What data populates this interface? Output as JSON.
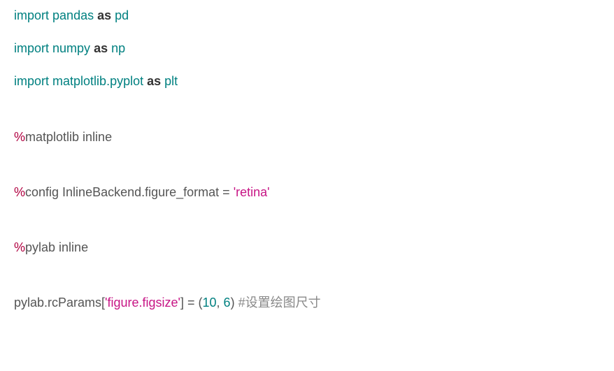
{
  "lines": {
    "line1": {
      "import": "import",
      "pandas": "pandas",
      "as": "as",
      "pd": "pd"
    },
    "line2": {
      "import": "import",
      "numpy": "numpy",
      "as": "as",
      "np": "np"
    },
    "line3": {
      "import": "import",
      "matplotlib": "matplotlib.pyplot",
      "as": "as",
      "plt": "plt"
    },
    "line4": {
      "magic": "%",
      "rest": "matplotlib inline"
    },
    "line5": {
      "magic": "%",
      "config": "config InlineBackend.figure_format = ",
      "quote1": "'",
      "retina": "retina",
      "quote2": "'"
    },
    "line6": {
      "magic": "%",
      "rest": "pylab inline"
    },
    "line7": {
      "pylab": "pylab.rcParams[",
      "quote1": "'",
      "figsize": "figure.figsize",
      "quote2": "'",
      "bracket_eq": "] = (",
      "ten": "10",
      "comma": ", ",
      "six": "6",
      "close": ") ",
      "comment": "#设置绘图尺寸"
    }
  }
}
